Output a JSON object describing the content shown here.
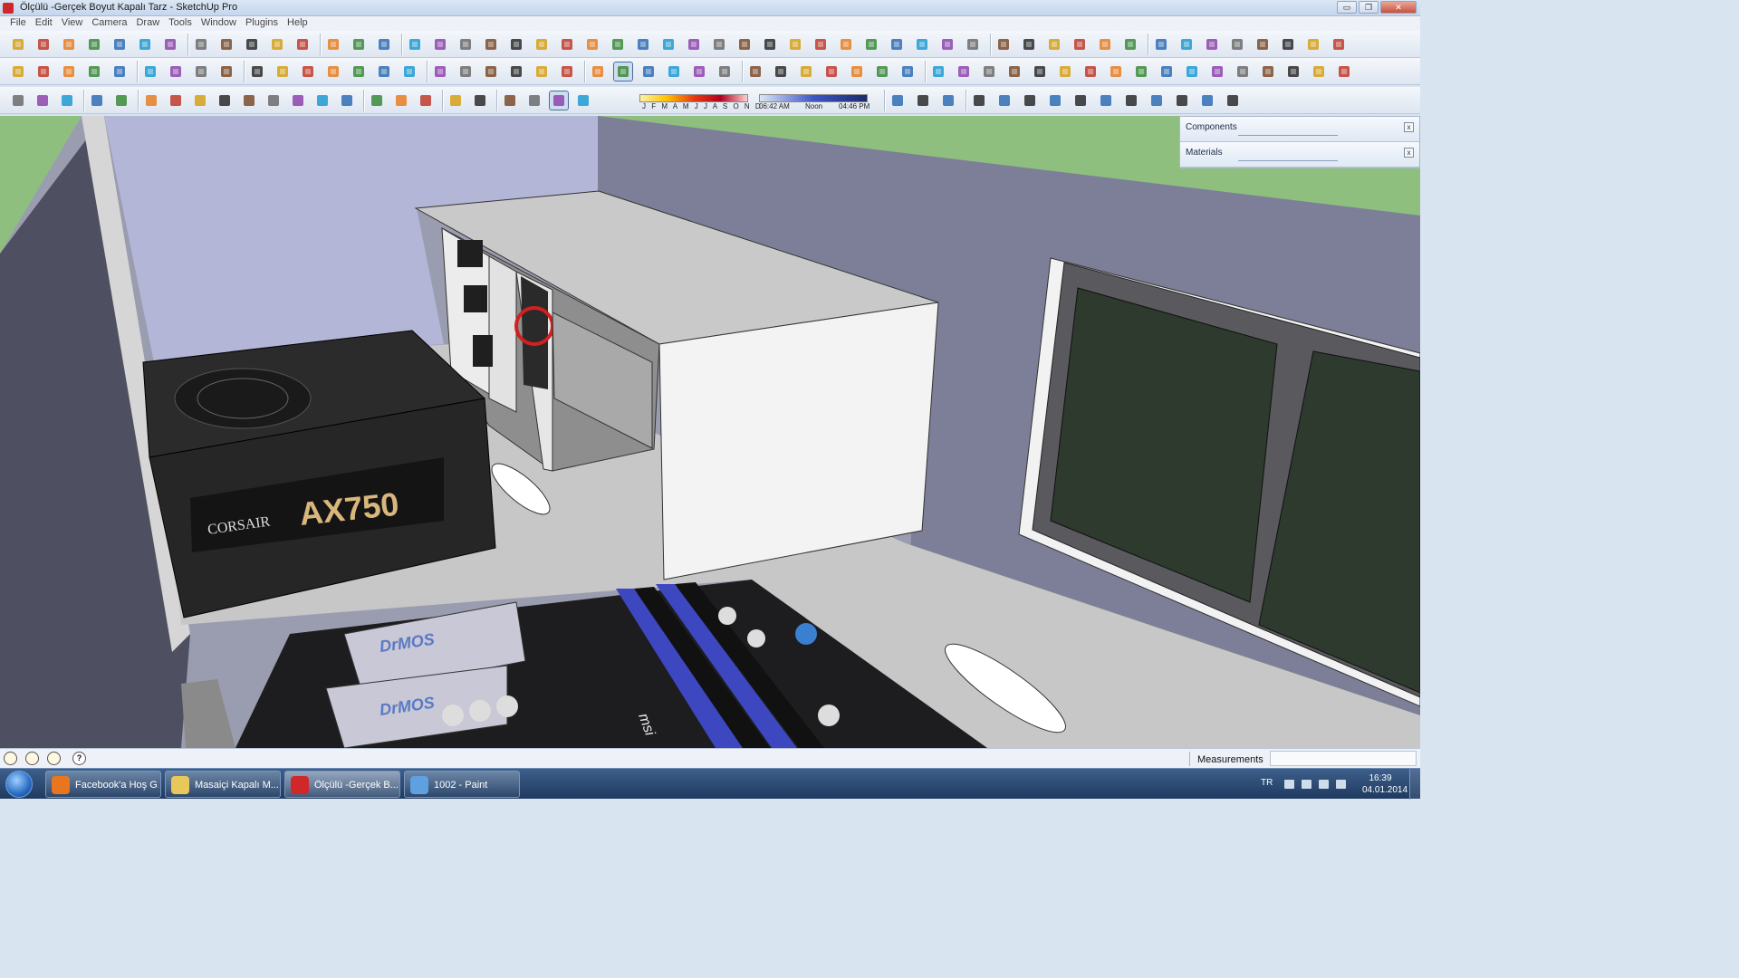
{
  "window": {
    "title": "Ölçülü -Gerçek Boyut Kapalı Tarz - SketchUp Pro",
    "minimize": "▭",
    "maximize": "❐",
    "close": "✕"
  },
  "menu": [
    "File",
    "Edit",
    "View",
    "Camera",
    "Draw",
    "Tools",
    "Window",
    "Plugins",
    "Help"
  ],
  "shadows": {
    "months": "J F M A M J J A S O N D",
    "time_start": "06:42 AM",
    "time_noon": "Noon",
    "time_end": "04:46 PM"
  },
  "tray": {
    "components_label": "Components",
    "materials_label": "Materials",
    "close_glyph": "x"
  },
  "model": {
    "psu_brand": "CORSAIR",
    "psu_model": "AX750",
    "heatsink_text": "DrMOS",
    "mb_brand": "msi"
  },
  "statusbar": {
    "measurements_label": "Measurements",
    "help_glyph": "?"
  },
  "taskbar": {
    "tasks": [
      {
        "label": "Facebook'a Hoş G...",
        "icon": "firefox-icon",
        "color": "#e8761e"
      },
      {
        "label": "Masaiçi Kapalı M...",
        "icon": "folder-icon",
        "color": "#e8c85a"
      },
      {
        "label": "Ölçülü -Gerçek B...",
        "icon": "sketchup-icon",
        "color": "#d0282a"
      },
      {
        "label": "1002 - Paint",
        "icon": "paint-icon",
        "color": "#5fa0e0"
      }
    ],
    "language": "TR",
    "time": "16:39",
    "date": "04.01.2014"
  },
  "colors": {
    "toolbar_bg": "#e4ebf4",
    "sky_green": "#8fbf7e",
    "case_wall": "#7c7f97",
    "floor": "#c6c6c6",
    "ram_blue": "#3d47c0"
  }
}
